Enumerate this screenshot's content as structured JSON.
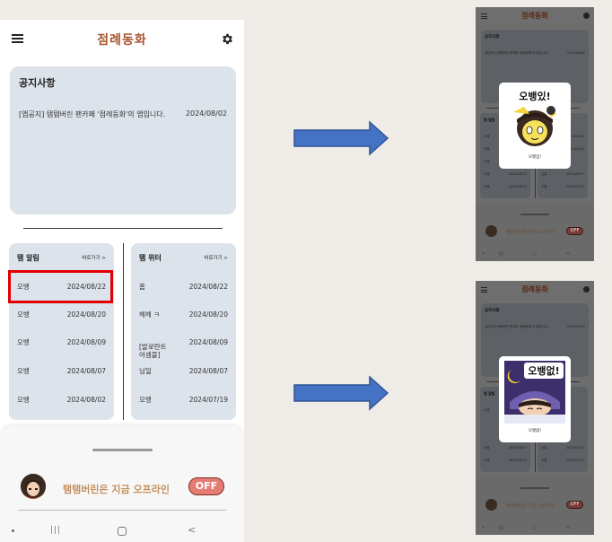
{
  "app": {
    "title": "점례동화"
  },
  "notice": {
    "title": "공지사항",
    "items": [
      {
        "text": "[앱공지] 탬탬버린 팬카페 '점례동화'의 앱입니다.",
        "date": "2024/08/02"
      }
    ]
  },
  "alarm_panel": {
    "title": "탬 알림",
    "go_label": "바로가기 >",
    "items": [
      {
        "text": "오뱅",
        "date": "2024/08/22"
      },
      {
        "text": "오뱅",
        "date": "2024/08/20"
      },
      {
        "text": "오뱅",
        "date": "2024/08/09"
      },
      {
        "text": "오뱅",
        "date": "2024/08/07"
      },
      {
        "text": "오뱅",
        "date": "2024/08/02"
      }
    ]
  },
  "twitter_panel": {
    "title": "탬 위터",
    "go_label": "바로가기 >",
    "items": [
      {
        "text": "홈",
        "date": "2024/08/22"
      },
      {
        "text": "헤헤 ㅋ",
        "date": "2024/08/20"
      },
      {
        "text": "[발로란트\n어셈블]",
        "date": "2024/08/09"
      },
      {
        "text": "님덜",
        "date": "2024/08/07"
      },
      {
        "text": "오뱅",
        "date": "2024/07/19"
      }
    ]
  },
  "status": {
    "text": "탬탬버린은 지금 오프라인",
    "toggle_label": "OFF"
  },
  "navbar": {
    "recent": "|||",
    "back": "<"
  },
  "mini_screens": [
    {
      "popup_title_art": "오뱅있!",
      "popup_caption": "오뱅임!"
    },
    {
      "popup_title_art": "오뱅없!",
      "popup_caption": "오뱅없!"
    }
  ],
  "colors": {
    "brand": "#a8552e",
    "panel_bg": "#dde3ea",
    "highlight": "#e00000",
    "arrow": "#4472c4",
    "off_toggle": "#e57c74"
  }
}
